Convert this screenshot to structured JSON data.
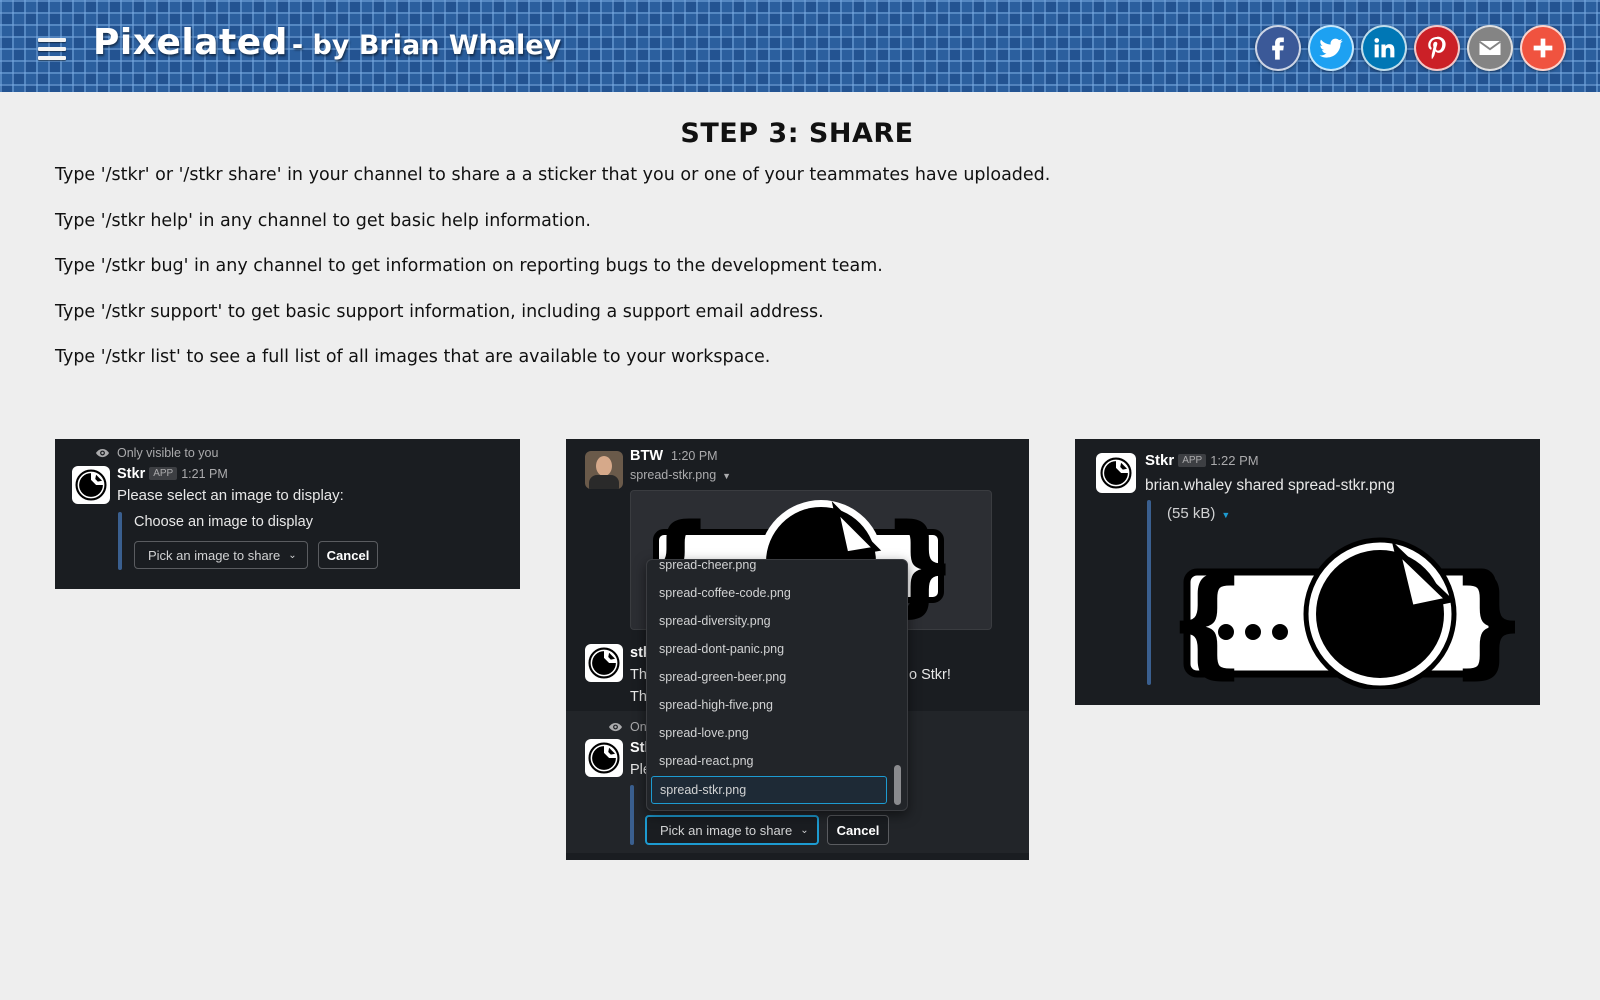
{
  "header": {
    "site_title": "Pixelated",
    "site_subtitle": "- by Brian Whaley",
    "share_icons": [
      {
        "name": "facebook-icon",
        "color": "#3b5998"
      },
      {
        "name": "twitter-icon",
        "color": "#1da1f2"
      },
      {
        "name": "linkedin-icon",
        "color": "#0077b5"
      },
      {
        "name": "pinterest-icon",
        "color": "#cb2027"
      },
      {
        "name": "email-icon",
        "color": "#848484"
      },
      {
        "name": "plus-icon",
        "color": "#f0533f"
      }
    ]
  },
  "main": {
    "title": "STEP 3: SHARE",
    "instructions": [
      "Type '/stkr' or '/stkr share' in your channel to share a a sticker that you or one of your teammates have uploaded.",
      "Type '/stkr help' in any channel to get basic help information.",
      "Type '/stkr bug' in any channel to get information on reporting bugs to the development team.",
      "Type '/stkr support' to get basic support information, including a support email address.",
      "Type '/stkr list' to see a full list of all images that are available to your workspace."
    ]
  },
  "panel1": {
    "visibility_note": "Only visible to you",
    "app_name": "Stkr",
    "app_badge": "APP",
    "time": "1:21 PM",
    "message": "Please select an image to display:",
    "prompt": "Choose an image to display",
    "select_label": "Pick an image to share",
    "cancel_label": "Cancel"
  },
  "panel2": {
    "user_name": "BTW",
    "time": "1:20 PM",
    "file_name": "spread-stkr.png",
    "partial_name": "stk",
    "partial_line1": "Th",
    "partial_line1_right": "o Stkr!",
    "partial_line2": "Th",
    "partial_note": "On",
    "partial_name2": "Stk",
    "partial_line3": "Ple",
    "dropdown_items": [
      "spread-cheer.png",
      "spread-coffee-code.png",
      "spread-diversity.png",
      "spread-dont-panic.png",
      "spread-green-beer.png",
      "spread-high-five.png",
      "spread-love.png",
      "spread-react.png",
      "spread-stkr.png"
    ],
    "select_label": "Pick an image to share",
    "cancel_label": "Cancel"
  },
  "panel3": {
    "app_name": "Stkr",
    "app_badge": "APP",
    "time": "1:22 PM",
    "message": "brian.whaley shared spread-stkr.png",
    "file_size": "(55 kB)"
  }
}
